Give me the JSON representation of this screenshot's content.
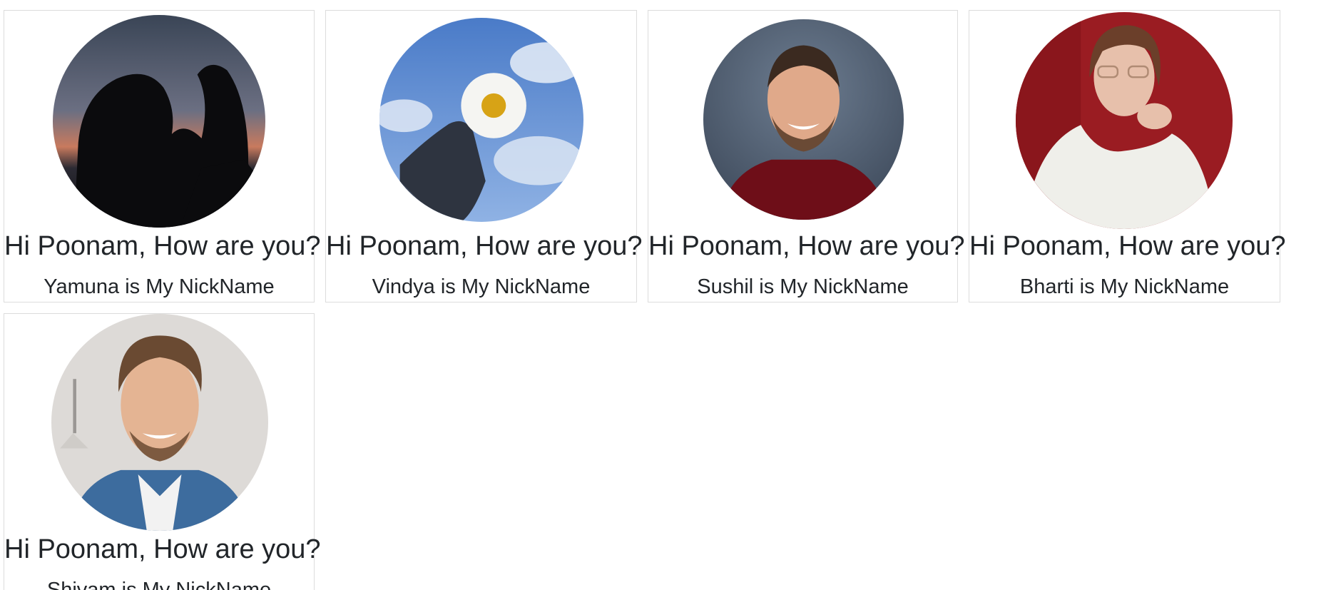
{
  "cards": [
    {
      "greeting": "Hi Poonam, How are you?",
      "nickname": "Yamuna is My NickName",
      "photo": "silhouette-sunset-photo"
    },
    {
      "greeting": "Hi Poonam, How are you?",
      "nickname": "Vindya is My NickName",
      "photo": "daisy-sky-photo"
    },
    {
      "greeting": "Hi Poonam, How are you?",
      "nickname": "Sushil is My NickName",
      "photo": "smiling-man-red-shirt-photo"
    },
    {
      "greeting": "Hi Poonam, How are you?",
      "nickname": "Bharti is My NickName",
      "photo": "woman-glasses-photo"
    },
    {
      "greeting": "Hi Poonam, How are you?",
      "nickname": "Shivam is My NickName",
      "photo": "smiling-man-denim-photo"
    }
  ],
  "colors": {
    "card_border": "#dcdcdc",
    "text": "#212529",
    "background": "#ffffff"
  }
}
